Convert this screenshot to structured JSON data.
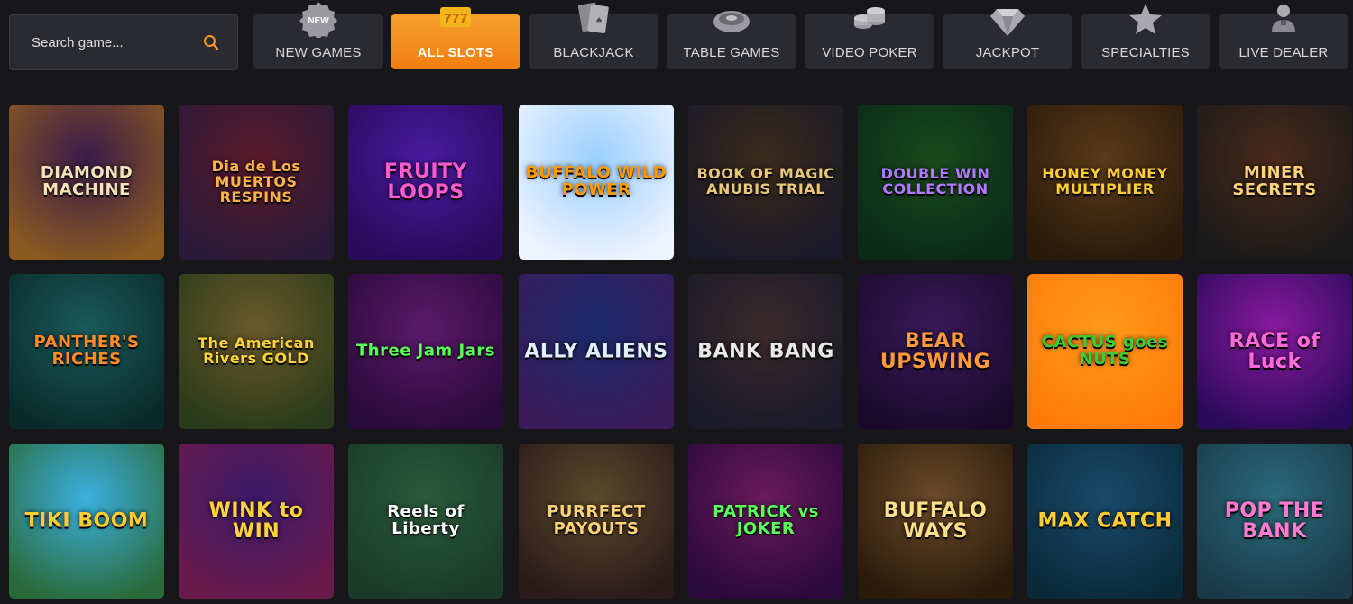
{
  "search": {
    "placeholder": "Search game...",
    "icon": "search-icon"
  },
  "tabs": [
    {
      "label": "NEW GAMES",
      "icon": "new-badge-icon",
      "active": false
    },
    {
      "label": "ALL SLOTS",
      "icon": "slot-777-icon",
      "active": true
    },
    {
      "label": "BLACKJACK",
      "icon": "cards-icon",
      "active": false
    },
    {
      "label": "TABLE GAMES",
      "icon": "roulette-icon",
      "active": false
    },
    {
      "label": "VIDEO POKER",
      "icon": "chips-icon",
      "active": false
    },
    {
      "label": "JACKPOT",
      "icon": "diamond-icon",
      "active": false
    },
    {
      "label": "SPECIALTIES",
      "icon": "star-icon",
      "active": false
    },
    {
      "label": "LIVE DEALER",
      "icon": "dealer-icon",
      "active": false
    }
  ],
  "games": [
    {
      "title": "DIAMOND MACHINE",
      "bg": [
        "#3a1a4a",
        "#8a5a20"
      ],
      "color": "#f4e2b8"
    },
    {
      "title": "Dia de Los MUERTOS RESPINS",
      "bg": [
        "#5a1a2a",
        "#2a1a3a"
      ],
      "color": "#ffb347"
    },
    {
      "title": "FRUITY LOOPS",
      "bg": [
        "#4a1aa0",
        "#2a0a5a"
      ],
      "color": "#ff5ad0"
    },
    {
      "title": "BUFFALO WILD POWER",
      "bg": [
        "#9ad0ff",
        "#f0f4ff"
      ],
      "color": "#ff9a00"
    },
    {
      "title": "BOOK OF MAGIC ANUBIS TRIAL",
      "bg": [
        "#3a2a1a",
        "#1a1a2a"
      ],
      "color": "#e8c878"
    },
    {
      "title": "DOUBLE WIN COLLECTION",
      "bg": [
        "#1a4a1a",
        "#0a2a1a"
      ],
      "color": "#b07aff"
    },
    {
      "title": "HONEY MONEY MULTIPLIER",
      "bg": [
        "#5a3a1a",
        "#2a1a0a"
      ],
      "color": "#ffcc33"
    },
    {
      "title": "MINER SECRETS",
      "bg": [
        "#4a2a1a",
        "#1a1a1a"
      ],
      "color": "#ffd27a"
    },
    {
      "title": "PANTHER'S RICHES",
      "bg": [
        "#1a5a5a",
        "#0a2a2a"
      ],
      "color": "#ff8a2a"
    },
    {
      "title": "The American Rivers GOLD",
      "bg": [
        "#6a5a2a",
        "#2a3a1a"
      ],
      "color": "#ffd23a"
    },
    {
      "title": "Three Jam Jars",
      "bg": [
        "#5a1a6a",
        "#2a0a3a"
      ],
      "color": "#5aff5a"
    },
    {
      "title": "ALLY ALIENS",
      "bg": [
        "#1a2a6a",
        "#3a1a5a"
      ],
      "color": "#e0f0ff"
    },
    {
      "title": "BANK BANG",
      "bg": [
        "#3a2a2a",
        "#1a1a2a"
      ],
      "color": "#e8e8e8"
    },
    {
      "title": "BEAR UPSWING",
      "bg": [
        "#3a1a5a",
        "#1a0a2a"
      ],
      "color": "#ff9a3a"
    },
    {
      "title": "CACTUS goes NUTS",
      "bg": [
        "#ff9a1a",
        "#ff7a0a"
      ],
      "color": "#3acc3a"
    },
    {
      "title": "RACE of Luck",
      "bg": [
        "#8a1aa0",
        "#2a0a5a"
      ],
      "color": "#ff6ad8"
    },
    {
      "title": "TIKI BOOM",
      "bg": [
        "#3ab0e0",
        "#2a6a3a"
      ],
      "color": "#ffcc33"
    },
    {
      "title": "WINK to WIN",
      "bg": [
        "#3a1a6a",
        "#6a1a4a"
      ],
      "color": "#ffd23a"
    },
    {
      "title": "Reels of Liberty",
      "bg": [
        "#2a5a3a",
        "#1a3a2a"
      ],
      "color": "#ffffff"
    },
    {
      "title": "PURRFECT PAYOUTS",
      "bg": [
        "#5a4a2a",
        "#2a1a1a"
      ],
      "color": "#ffd27a"
    },
    {
      "title": "PATRICK vs JOKER",
      "bg": [
        "#6a1a5a",
        "#2a0a3a"
      ],
      "color": "#5aff5a"
    },
    {
      "title": "BUFFALO WAYS",
      "bg": [
        "#6a4a2a",
        "#2a1a0a"
      ],
      "color": "#ffe08a"
    },
    {
      "title": "MAX CATCH",
      "bg": [
        "#1a4a6a",
        "#0a2a3a"
      ],
      "color": "#ffcc33"
    },
    {
      "title": "POP THE BANK",
      "bg": [
        "#2a6a7a",
        "#1a3a4a"
      ],
      "color": "#ff7ad0"
    }
  ]
}
